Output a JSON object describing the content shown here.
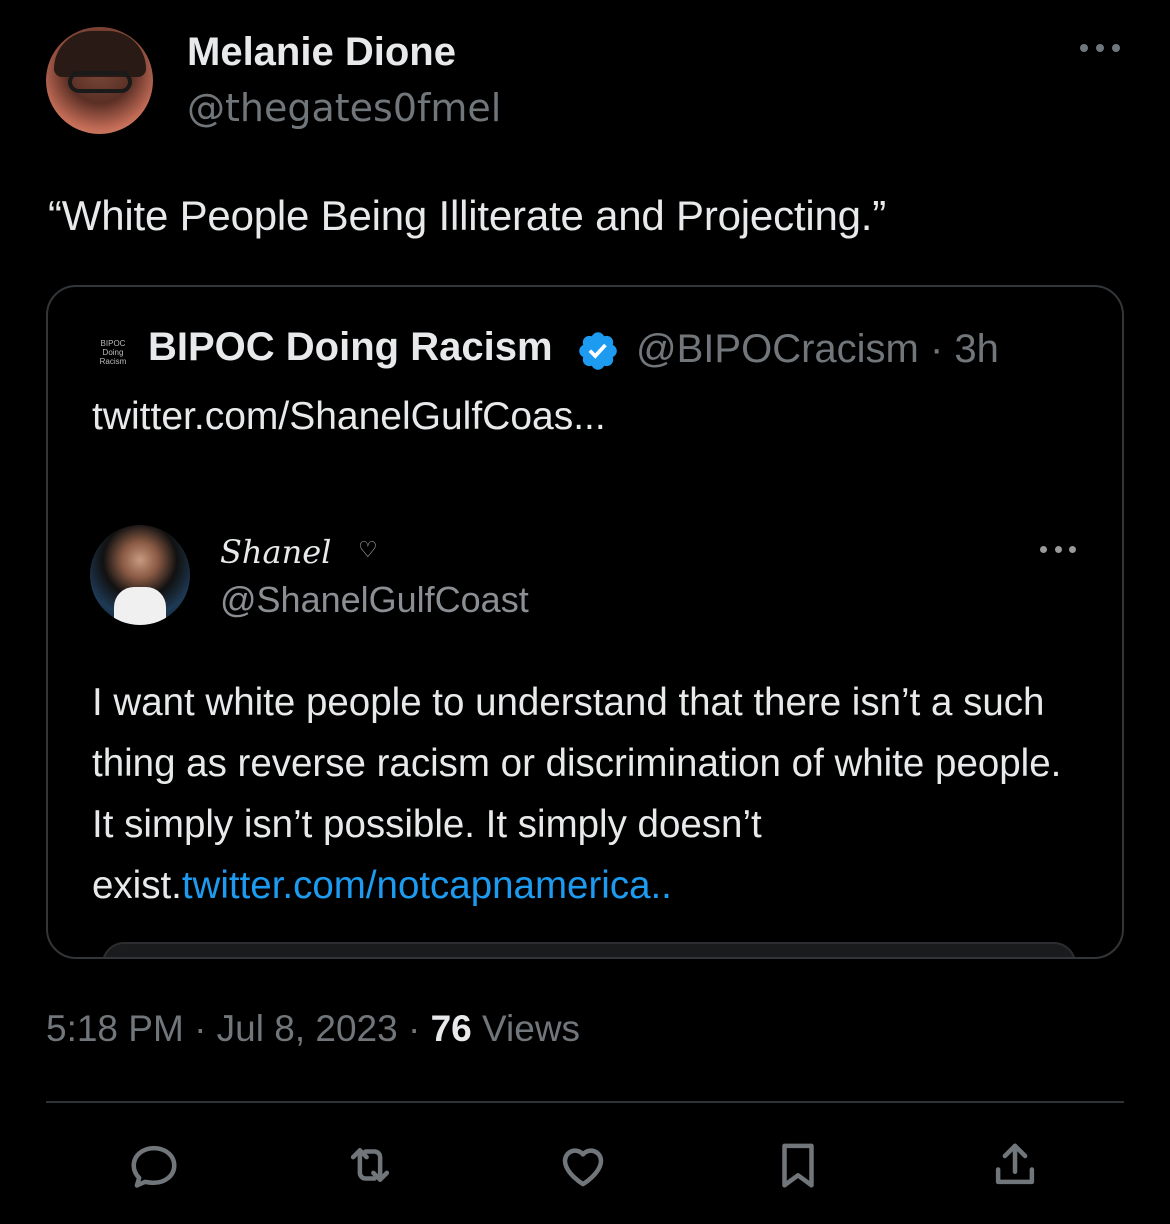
{
  "author": {
    "name": "Melanie Dione",
    "handle": "@thegates0fmel"
  },
  "tweet_text": "“White People Being Illiterate and Projecting.”",
  "quoted": {
    "avatar_text": [
      "BIPOC",
      "Doing",
      "Racism"
    ],
    "name": "BIPOC Doing Racism",
    "handle_time": "@BIPOCracism · 3h",
    "link_text": "twitter.com/ShanelGulfCoas...",
    "verified_color": "#1d9bf0",
    "embedded": {
      "name": "Shanel",
      "heart": "♡",
      "handle": "@ShanelGulfCoast",
      "text": "I want white people to understand that there isn’t a such thing as reverse racism or discrimination of white people. It simply isn’t possible. It simply doesn’t exist.",
      "link": "twitter.com/notcapnamerica.."
    }
  },
  "meta": {
    "timestamp": "5:18 PM · Jul 8, 2023 · ",
    "views_count": "76",
    "views_label": " Views"
  },
  "actions": [
    "reply-icon",
    "retweet-icon",
    "like-icon",
    "bookmark-icon",
    "share-icon"
  ],
  "colors": {
    "background": "#000000",
    "text": "#e7e9ea",
    "muted": "#71767b",
    "link": "#1d9bf0"
  }
}
